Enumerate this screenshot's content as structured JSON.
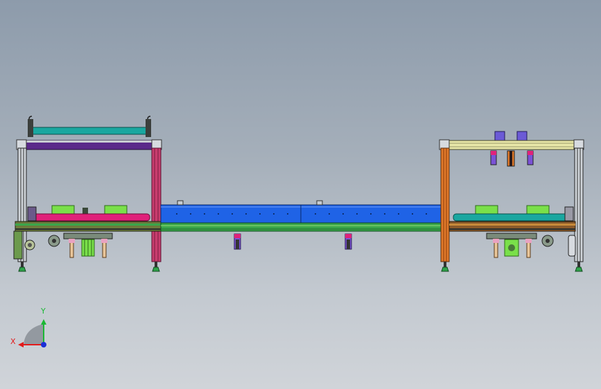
{
  "viewport": {
    "background_top": "#8d9bab",
    "background_bottom": "#d0d4d9"
  },
  "axes": {
    "x_label": "X",
    "y_label": "Y",
    "x_color": "#e21b1b",
    "y_color": "#1bb834",
    "z_color": "#1a2fd6"
  },
  "palette": {
    "frame_dark": "#2a2e2c",
    "frame_light": "#c8cdd2",
    "roller_teal": "#1aa7a0",
    "roller_magenta": "#e0217a",
    "rail_purple": "#5a2a8a",
    "rail_yellow": "#e8e7a8",
    "conveyor_blue": "#1f63e6",
    "post_magenta": "#c83d6e",
    "post_orange": "#e0792a",
    "base_green": "#3aa64a",
    "base_olive": "#6c7a3c",
    "block_green": "#7ae04a",
    "cylinder_pink": "#e9a2c2",
    "cylinder_violet": "#7a52d6",
    "foot_green": "#2fa34a"
  }
}
